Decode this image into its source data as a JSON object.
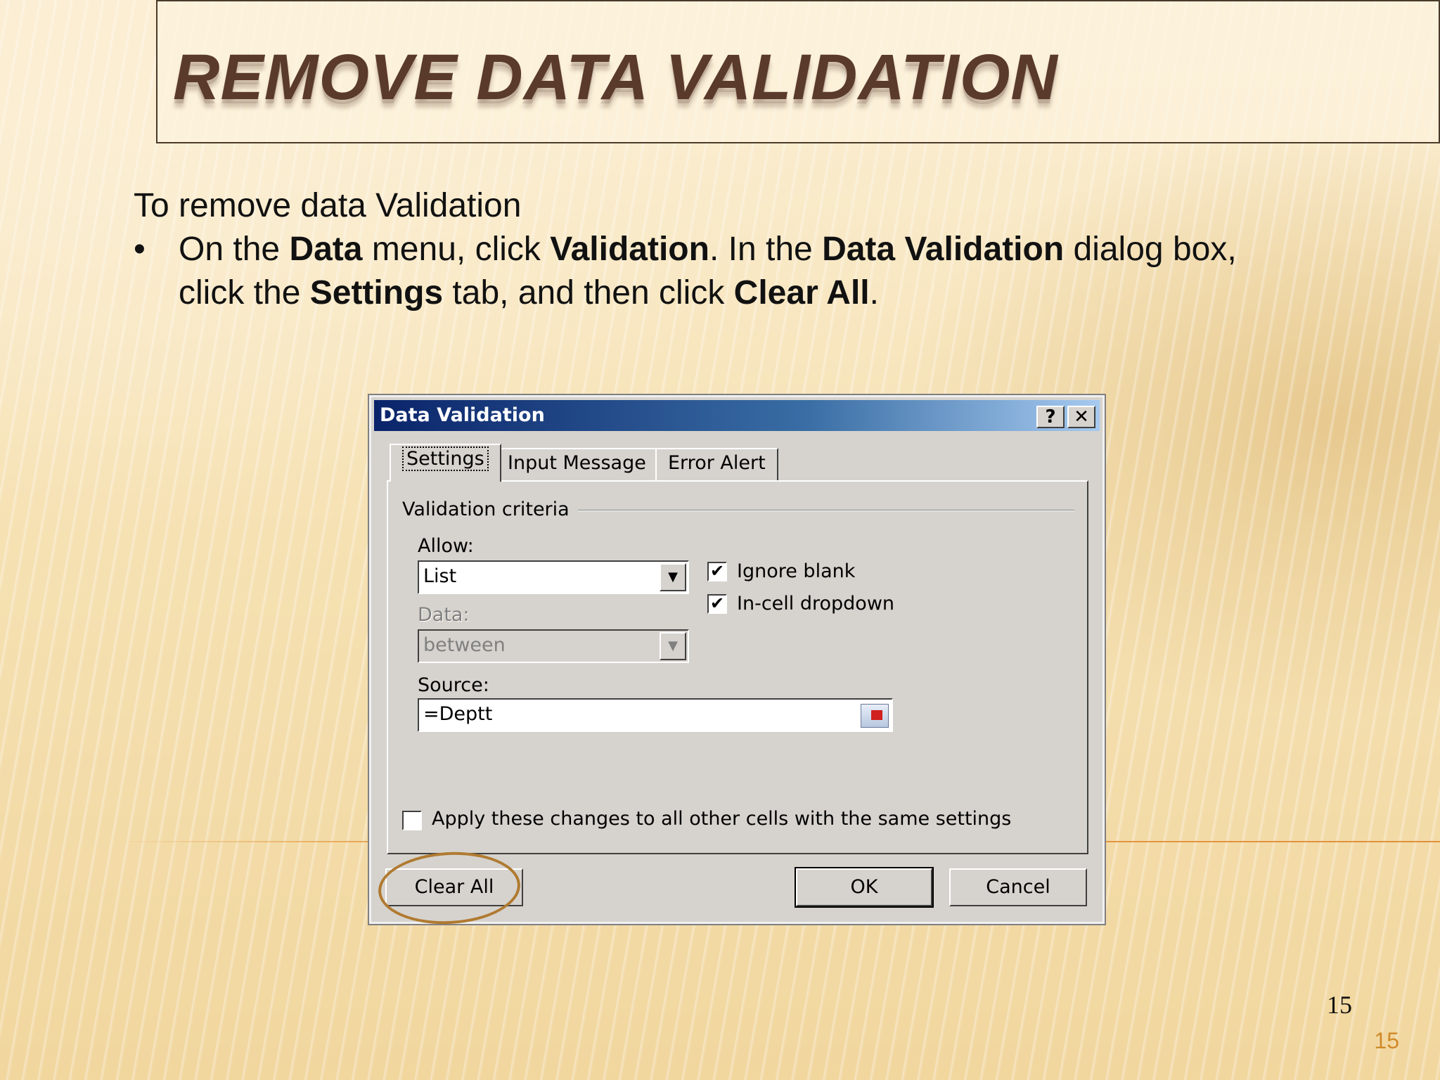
{
  "slide": {
    "title": "REMOVE DATA VALIDATION",
    "intro": "To remove data Validation",
    "bullet_dot": "•",
    "bullet": {
      "t1": "On the ",
      "b1": "Data",
      "t2": " menu, click ",
      "b2": "Validation",
      "t3": ". In the ",
      "b3": "Data Validation",
      "t4": " dialog box, click the ",
      "b4": "Settings",
      "t5": " tab, and then click ",
      "b5": "Clear All",
      "t6": "."
    },
    "page_number_black": "15",
    "page_number_orange": "15",
    "accent_color": "#5a3a2b"
  },
  "dialog": {
    "title": "Data Validation",
    "help_button": "?",
    "close_button": "✕",
    "tabs": [
      {
        "label": "Settings",
        "active": true
      },
      {
        "label": "Input Message",
        "active": false
      },
      {
        "label": "Error Alert",
        "active": false
      }
    ],
    "group_label": "Validation criteria",
    "allow_label": "Allow:",
    "allow_value": "List",
    "data_label": "Data:",
    "data_value": "between",
    "source_label": "Source:",
    "source_value": "=Deptt",
    "ignore_blank_label": "Ignore blank",
    "ignore_blank_checked": true,
    "incell_dropdown_label": "In-cell dropdown",
    "incell_dropdown_checked": true,
    "apply_all_label": "Apply these changes to all other cells with the same settings",
    "apply_all_checked": false,
    "check_mark": "✔",
    "dropdown_arrow": "▼",
    "buttons": {
      "clear_all": "Clear All",
      "ok": "OK",
      "cancel": "Cancel"
    }
  }
}
